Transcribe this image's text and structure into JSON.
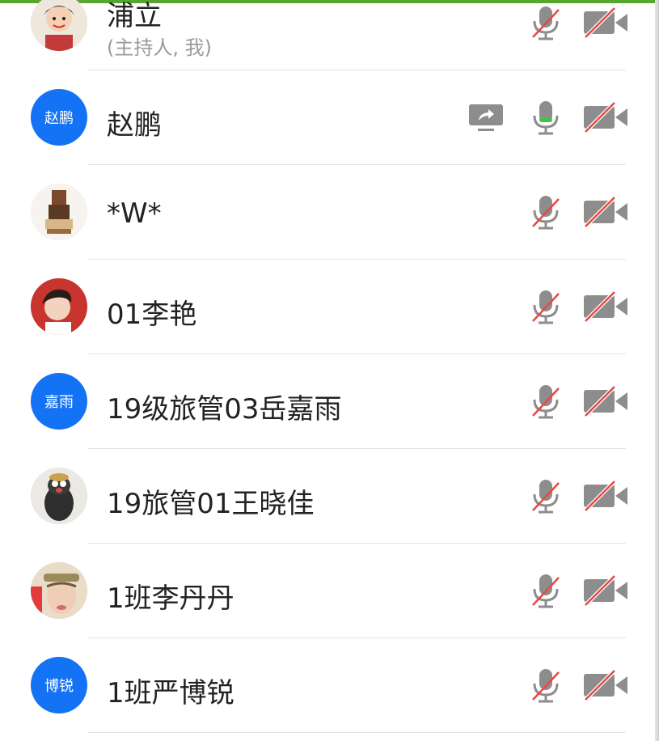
{
  "participants": [
    {
      "name": "浦立",
      "subtitle": "(主持人, 我)",
      "avatar": {
        "type": "image",
        "icon": "cartoon-avatar-icon"
      },
      "mic": "muted",
      "camera": "off",
      "sharing": false
    },
    {
      "name": "赵鹏",
      "subtitle": "",
      "avatar": {
        "type": "initials",
        "text": "赵鹏",
        "color": "#1472f5"
      },
      "mic": "active",
      "camera": "off",
      "sharing": true
    },
    {
      "name": "*W*",
      "subtitle": "",
      "avatar": {
        "type": "image",
        "icon": "cartoon-figure-icon"
      },
      "mic": "muted",
      "camera": "off",
      "sharing": false
    },
    {
      "name": "01李艳",
      "subtitle": "",
      "avatar": {
        "type": "image",
        "icon": "person-photo-icon"
      },
      "mic": "muted",
      "camera": "off",
      "sharing": false
    },
    {
      "name": "19级旅管03岳嘉雨",
      "subtitle": "",
      "avatar": {
        "type": "initials",
        "text": "嘉雨",
        "color": "#1472f5"
      },
      "mic": "muted",
      "camera": "off",
      "sharing": false
    },
    {
      "name": "19旅管01王晓佳",
      "subtitle": "",
      "avatar": {
        "type": "image",
        "icon": "mole-cartoon-icon"
      },
      "mic": "muted",
      "camera": "off",
      "sharing": false
    },
    {
      "name": "1班李丹丹",
      "subtitle": "",
      "avatar": {
        "type": "image",
        "icon": "selfie-photo-icon"
      },
      "mic": "muted",
      "camera": "off",
      "sharing": false
    },
    {
      "name": "1班严博锐",
      "subtitle": "",
      "avatar": {
        "type": "initials",
        "text": "博锐",
        "color": "#1472f5"
      },
      "mic": "muted",
      "camera": "off",
      "sharing": false
    }
  ],
  "colors": {
    "accent_green": "#5aa52f",
    "initials_blue": "#1472f5",
    "icon_gray": "#8d8d8d",
    "mute_red": "#e8493f",
    "mic_active_green": "#3ec24a"
  }
}
